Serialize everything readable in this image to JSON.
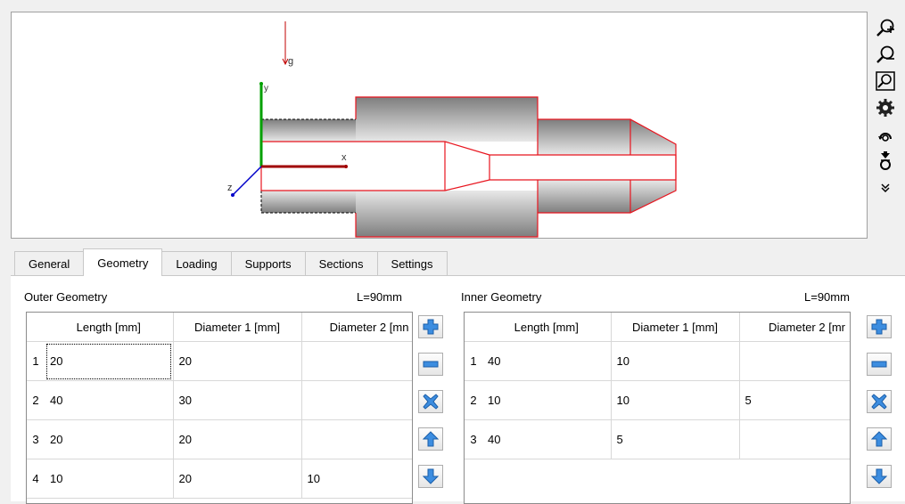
{
  "viewport": {
    "labels": {
      "gravity": "g",
      "y_axis": "y",
      "x_axis": "x",
      "z_axis": "z"
    }
  },
  "toolbar": {
    "icons": [
      "zoom-in-icon",
      "zoom-out-icon",
      "zoom-fit-icon",
      "settings-gear-icon",
      "rotate-icon",
      "export-icon",
      "more-chevron-icon"
    ]
  },
  "tabs": [
    {
      "label": "General",
      "active": false
    },
    {
      "label": "Geometry",
      "active": true
    },
    {
      "label": "Loading",
      "active": false
    },
    {
      "label": "Supports",
      "active": false
    },
    {
      "label": "Sections",
      "active": false
    },
    {
      "label": "Settings",
      "active": false
    }
  ],
  "outer": {
    "title": "Outer Geometry",
    "total": "L=90mm",
    "columns": [
      "Length [mm]",
      "Diameter 1 [mm]",
      "Diameter 2 [mn"
    ],
    "rows": [
      {
        "n": "1",
        "cells": [
          "20",
          "20",
          ""
        ]
      },
      {
        "n": "2",
        "cells": [
          "40",
          "30",
          ""
        ]
      },
      {
        "n": "3",
        "cells": [
          "20",
          "20",
          ""
        ]
      },
      {
        "n": "4",
        "cells": [
          "10",
          "20",
          "10"
        ]
      }
    ]
  },
  "inner": {
    "title": "Inner Geometry",
    "total": "L=90mm",
    "columns": [
      "Length [mm]",
      "Diameter 1 [mm]",
      "Diameter 2 [mr"
    ],
    "rows": [
      {
        "n": "1",
        "cells": [
          "40",
          "10",
          ""
        ]
      },
      {
        "n": "2",
        "cells": [
          "10",
          "10",
          "5"
        ]
      },
      {
        "n": "3",
        "cells": [
          "40",
          "5",
          ""
        ]
      }
    ]
  },
  "side_buttons": [
    "add-row-icon",
    "remove-row-icon",
    "delete-all-icon",
    "move-up-icon",
    "move-down-icon"
  ],
  "colors": {
    "outline": "#e8141e",
    "axis_y": "#00a000",
    "axis_x": "#a00000",
    "axis_z": "#0000c8",
    "button_blue": "#3c8de0"
  }
}
